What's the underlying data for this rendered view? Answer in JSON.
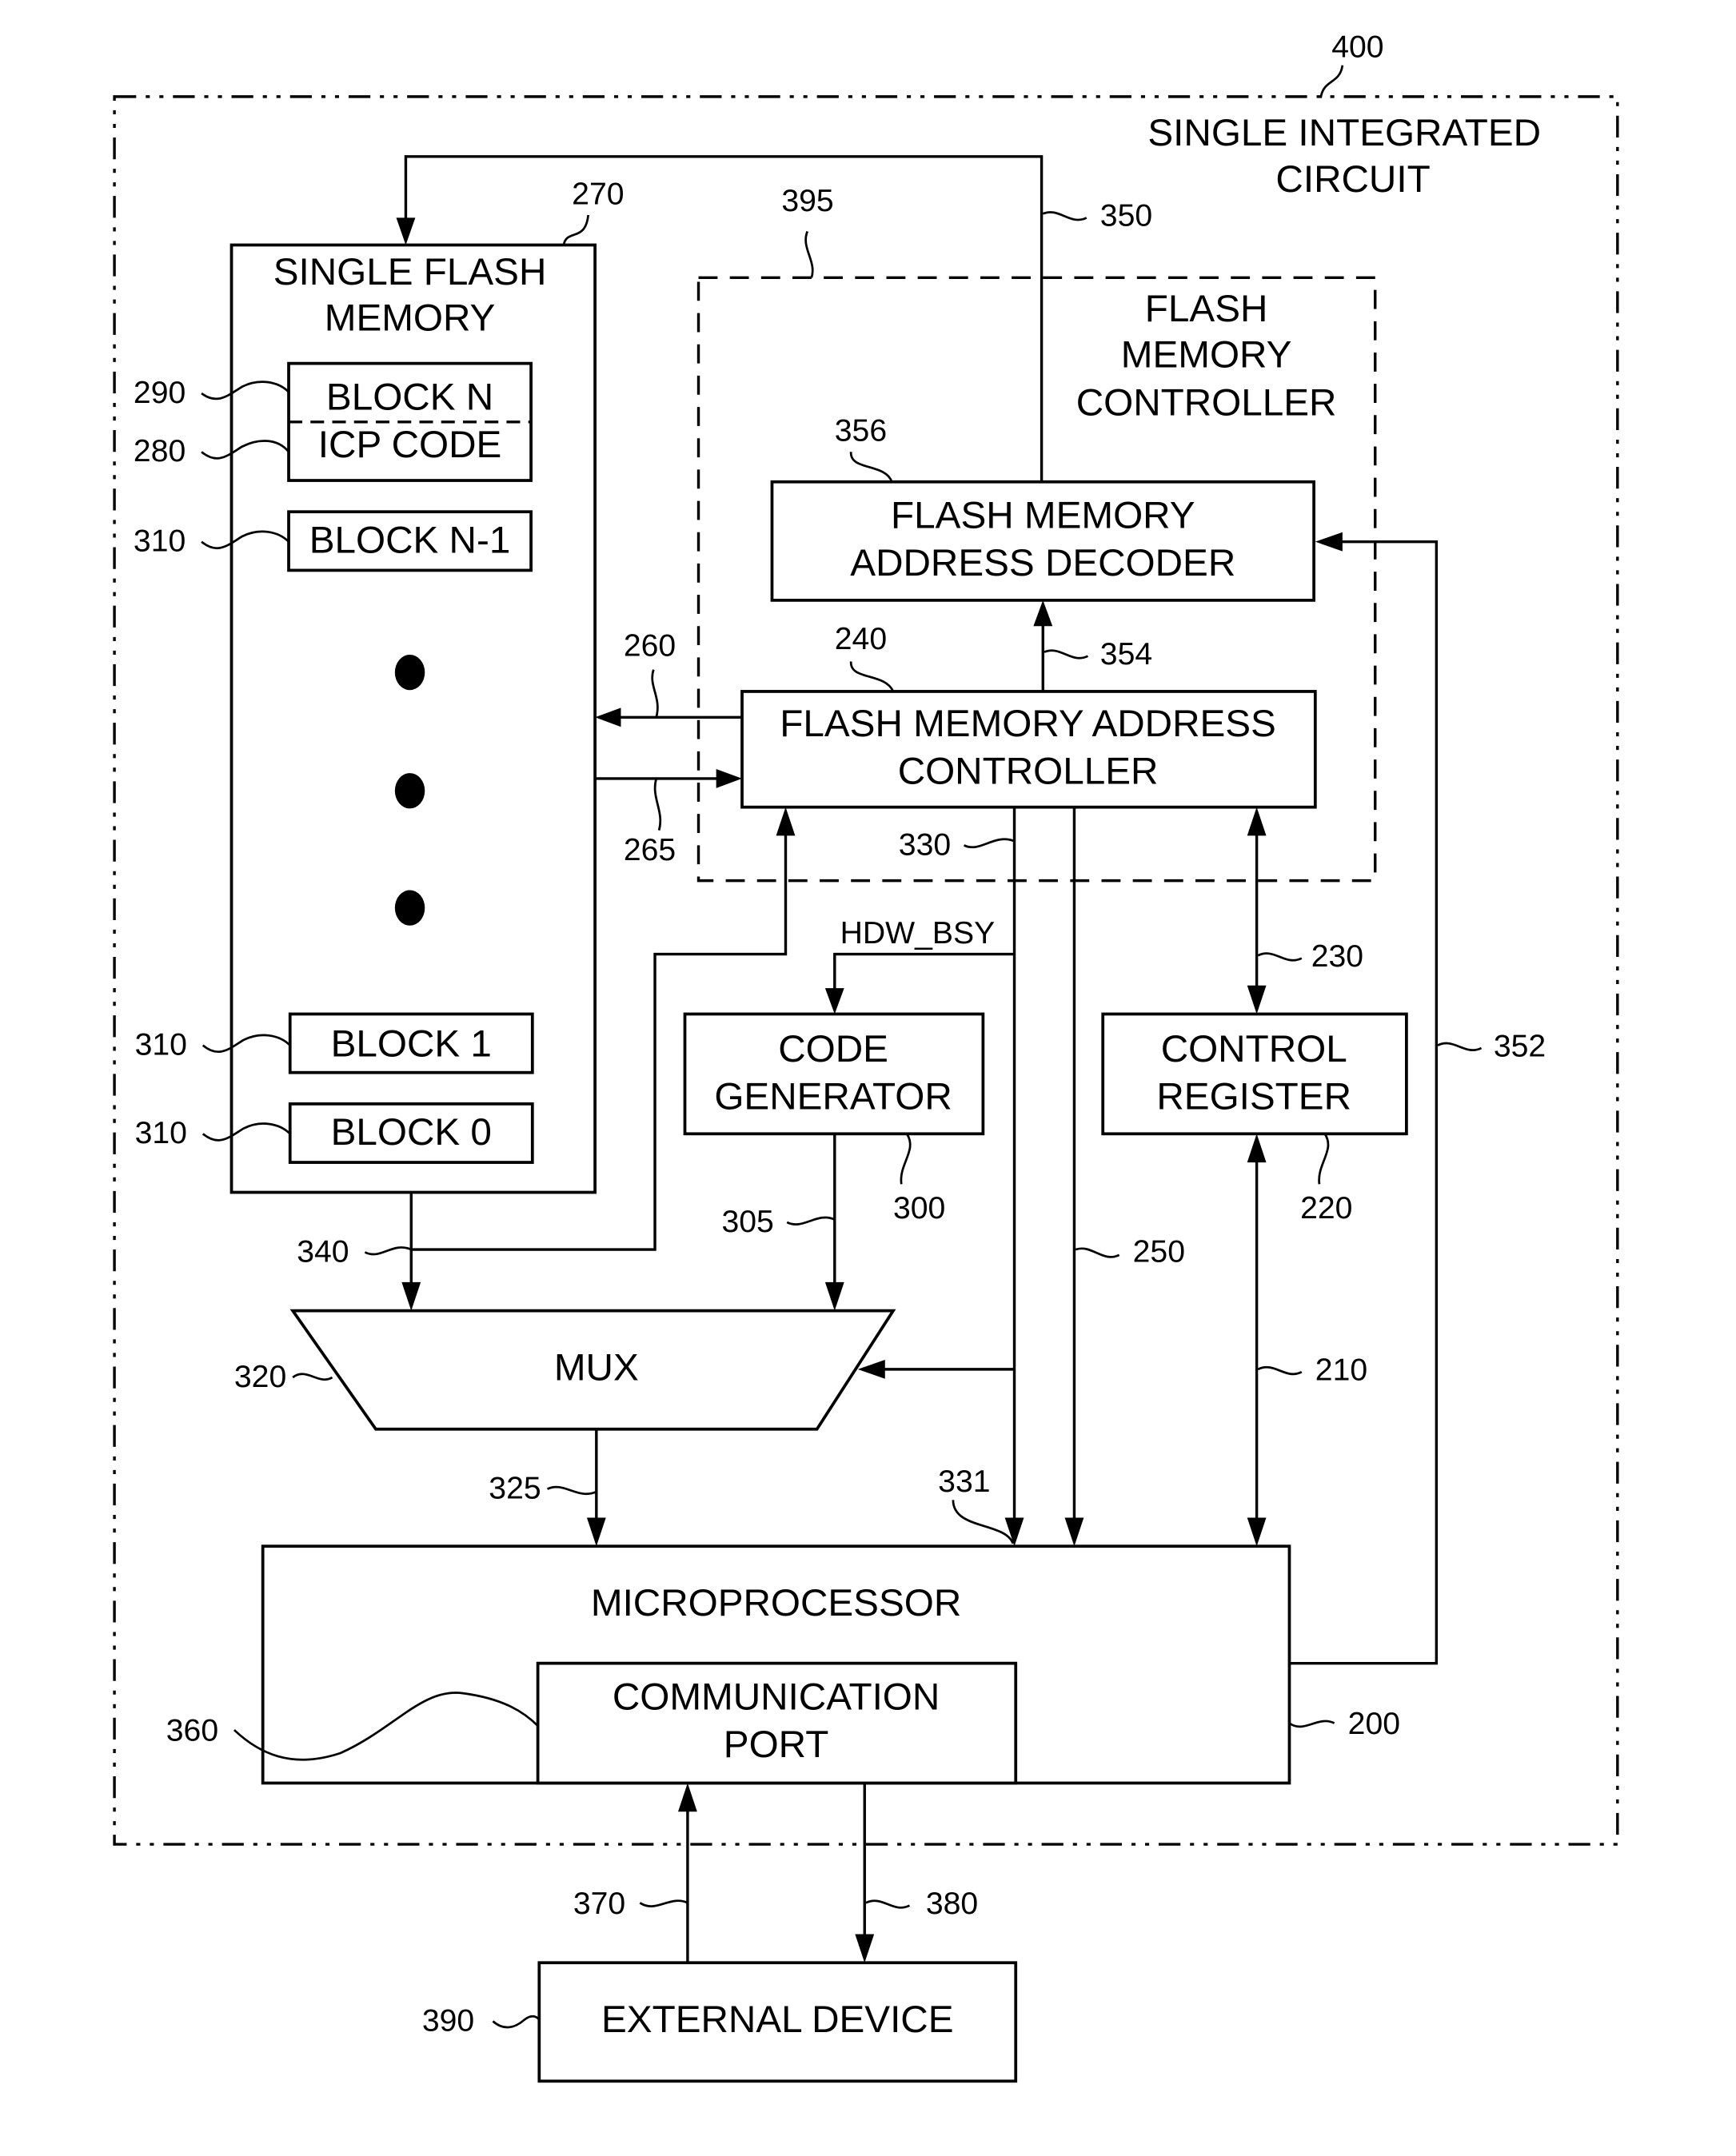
{
  "figure": {
    "container": {
      "ref": "400",
      "title_line1": "SINGLE INTEGRATED",
      "title_line2": "CIRCUIT"
    },
    "flash_controller_group": {
      "ref": "395",
      "title_line1": "FLASH",
      "title_line2": "MEMORY",
      "title_line3": "CONTROLLER"
    },
    "single_flash_memory": {
      "ref": "270",
      "title_line1": "SINGLE FLASH",
      "title_line2": "MEMORY",
      "blocks": [
        {
          "ref": "290",
          "label": "BLOCK N"
        },
        {
          "ref": "280",
          "label": "ICP CODE"
        },
        {
          "ref": "310",
          "label": "BLOCK N-1"
        },
        {
          "ref": "310",
          "label": "BLOCK 1"
        },
        {
          "ref": "310",
          "label": "BLOCK 0"
        }
      ]
    },
    "address_decoder": {
      "ref": "356",
      "line1": "FLASH MEMORY",
      "line2": "ADDRESS DECODER"
    },
    "address_controller": {
      "ref": "240",
      "line1": "FLASH MEMORY ADDRESS",
      "line2": "CONTROLLER"
    },
    "code_generator": {
      "ref": "300",
      "line1": "CODE",
      "line2": "GENERATOR"
    },
    "control_register": {
      "ref": "220",
      "line1": "CONTROL",
      "line2": "REGISTER"
    },
    "mux": {
      "ref": "320",
      "label": "MUX"
    },
    "microprocessor": {
      "ref": "200",
      "label": "MICROPROCESSOR"
    },
    "communication_port": {
      "ref": "360",
      "line1": "COMMUNICATION",
      "line2": "PORT"
    },
    "external_device": {
      "ref": "390",
      "label": "EXTERNAL DEVICE"
    },
    "signals": {
      "hdw_bsy": "HDW_BSY",
      "s350": "350",
      "s354": "354",
      "s352": "352",
      "s260": "260",
      "s265": "265",
      "s330": "330",
      "s331": "331",
      "s230": "230",
      "s210": "210",
      "s250": "250",
      "s340": "340",
      "s305": "305",
      "s325": "325",
      "s370": "370",
      "s380": "380"
    }
  }
}
